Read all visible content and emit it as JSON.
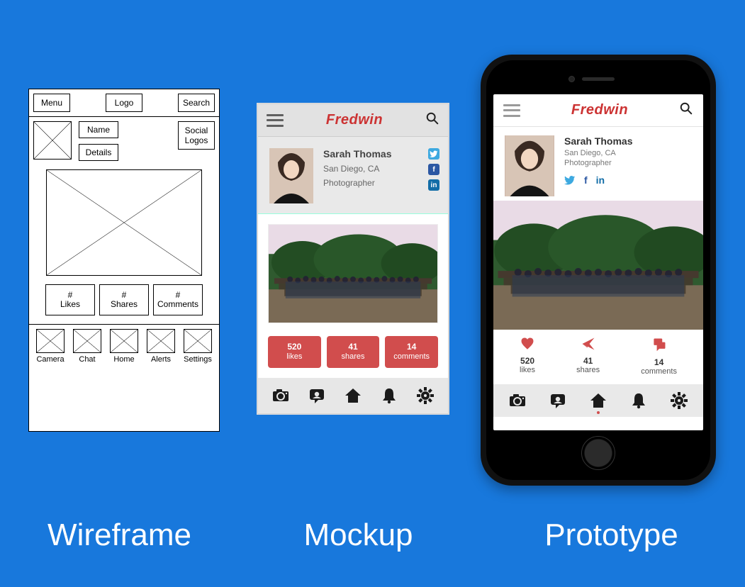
{
  "captions": {
    "wireframe": "Wireframe",
    "mockup": "Mockup",
    "prototype": "Prototype"
  },
  "wireframe": {
    "top": {
      "menu": "Menu",
      "logo": "Logo",
      "search": "Search"
    },
    "profile": {
      "name": "Name",
      "details": "Details",
      "social": "Social\nLogos"
    },
    "stats": {
      "likes": {
        "hash": "#",
        "label": "Likes"
      },
      "shares": {
        "hash": "#",
        "label": "Shares"
      },
      "comments": {
        "hash": "#",
        "label": "Comments"
      }
    },
    "nav": {
      "camera": "Camera",
      "chat": "Chat",
      "home": "Home",
      "alerts": "Alerts",
      "settings": "Settings"
    }
  },
  "app": {
    "brand": "Fredwin",
    "user": {
      "name": "Sarah Thomas",
      "location": "San Diego, CA",
      "title": "Photographer"
    },
    "stats": {
      "likes": {
        "count": "520",
        "label": "likes"
      },
      "shares": {
        "count": "41",
        "label": "shares"
      },
      "comments": {
        "count": "14",
        "label": "comments"
      }
    },
    "social": {
      "twitter_glyph": "t",
      "facebook_glyph": "f",
      "linkedin_glyph": "in"
    }
  }
}
